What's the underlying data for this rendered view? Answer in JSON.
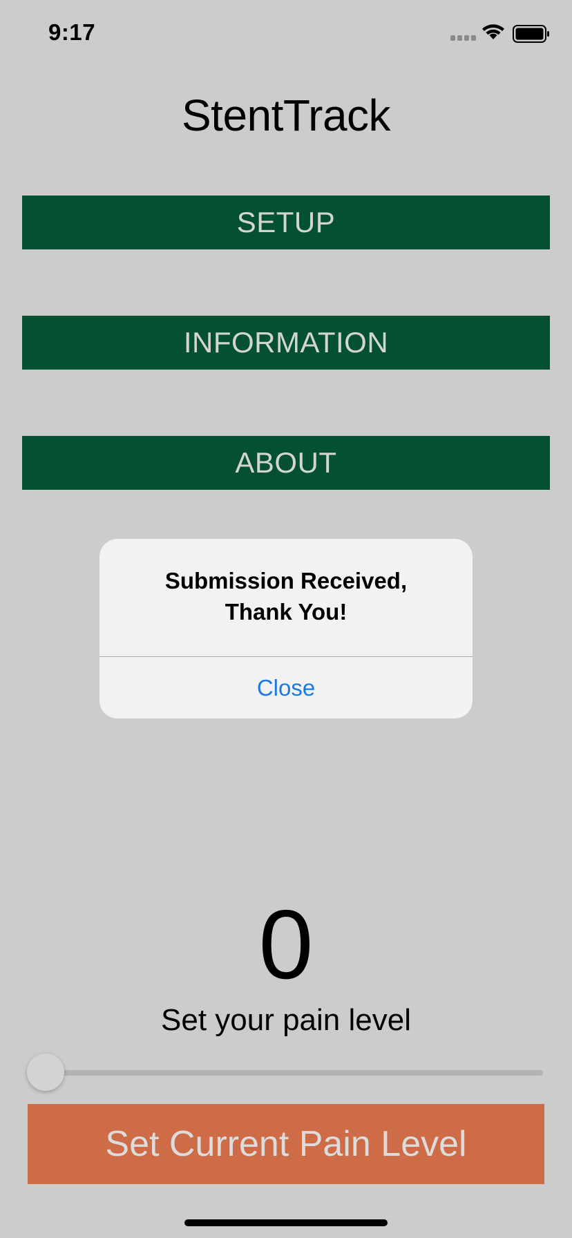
{
  "status_bar": {
    "time": "9:17",
    "icons": [
      "cellular-signal-icon",
      "wifi-icon",
      "battery-icon"
    ]
  },
  "app": {
    "title": "StentTrack"
  },
  "nav": {
    "setup_label": "SETUP",
    "information_label": "INFORMATION",
    "about_label": "ABOUT"
  },
  "alert": {
    "title_line1": "Submission Received,",
    "title_line2": "Thank You!",
    "close_label": "Close"
  },
  "pain": {
    "value": "0",
    "caption": "Set your pain level",
    "slider_fraction": 0,
    "submit_label": "Set Current Pain Level"
  },
  "colors": {
    "background": "#cccccc",
    "nav_button": "#045131",
    "submit_button": "#cd6c46",
    "alert_link": "#1b79e6"
  }
}
